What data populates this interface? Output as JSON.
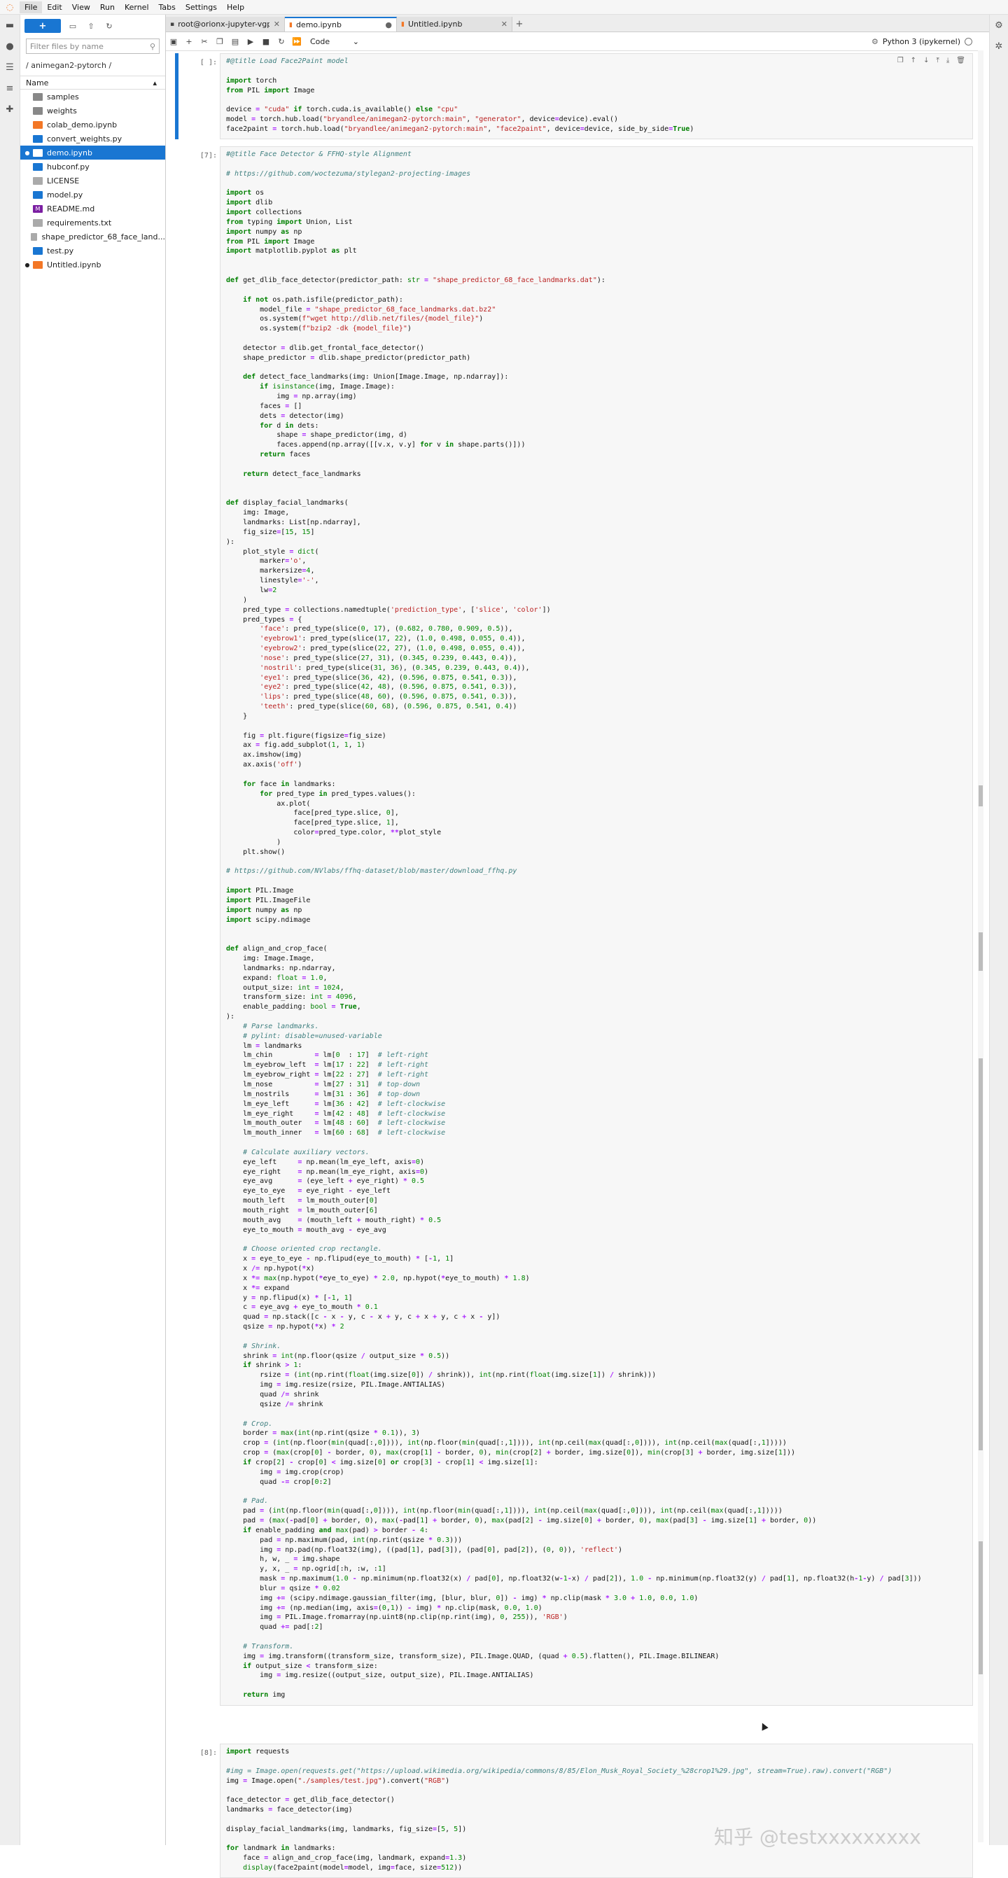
{
  "menubar": {
    "items": [
      "File",
      "Edit",
      "View",
      "Run",
      "Kernel",
      "Tabs",
      "Settings",
      "Help"
    ]
  },
  "filebrowser": {
    "new_label": "+",
    "search_placeholder": "Filter files by name",
    "breadcrumb": "/ animegan2-pytorch /",
    "column_name": "Name",
    "files": [
      {
        "name": "samples",
        "type": "folder",
        "running": false,
        "selected": false
      },
      {
        "name": "weights",
        "type": "folder",
        "running": false,
        "selected": false
      },
      {
        "name": "colab_demo.ipynb",
        "type": "notebook",
        "running": false,
        "selected": false
      },
      {
        "name": "convert_weights.py",
        "type": "python",
        "running": false,
        "selected": false
      },
      {
        "name": "demo.ipynb",
        "type": "notebook",
        "running": true,
        "selected": true
      },
      {
        "name": "hubconf.py",
        "type": "python",
        "running": false,
        "selected": false
      },
      {
        "name": "LICENSE",
        "type": "text",
        "running": false,
        "selected": false
      },
      {
        "name": "model.py",
        "type": "python",
        "running": false,
        "selected": false
      },
      {
        "name": "README.md",
        "type": "markdown",
        "running": false,
        "selected": false
      },
      {
        "name": "requirements.txt",
        "type": "text",
        "running": false,
        "selected": false
      },
      {
        "name": "shape_predictor_68_face_land...",
        "type": "text",
        "running": false,
        "selected": false
      },
      {
        "name": "test.py",
        "type": "python",
        "running": false,
        "selected": false
      },
      {
        "name": "Untitled.ipynb",
        "type": "notebook",
        "running": true,
        "selected": false
      }
    ]
  },
  "tabs": [
    {
      "label": "root@orionx-jupyter-vgpu:",
      "active": false
    },
    {
      "label": "demo.ipynb",
      "active": true
    },
    {
      "label": "Untitled.ipynb",
      "active": false
    }
  ],
  "toolbar": {
    "cell_type": "Code",
    "kernel": "Python 3 (ipykernel)"
  },
  "cells": [
    {
      "prompt": "[ ]:",
      "active": true,
      "lines": [
        "#@title Load Face2Paint model",
        "",
        "import torch",
        "from PIL import Image",
        "",
        "device = \"cuda\" if torch.cuda.is_available() else \"cpu\"",
        "model = torch.hub.load(\"bryandlee/animegan2-pytorch:main\", \"generator\", device=device).eval()",
        "face2paint = torch.hub.load(\"bryandlee/animegan2-pytorch:main\", \"face2paint\", device=device, side_by_side=True)"
      ]
    },
    {
      "prompt": "[7]:",
      "active": false,
      "lines": [
        "#@title Face Detector & FFHQ-style Alignment",
        "",
        "# https://github.com/woctezuma/stylegan2-projecting-images",
        "",
        "import os",
        "import dlib",
        "import collections",
        "from typing import Union, List",
        "import numpy as np",
        "from PIL import Image",
        "import matplotlib.pyplot as plt",
        "",
        "",
        "def get_dlib_face_detector(predictor_path: str = \"shape_predictor_68_face_landmarks.dat\"):",
        "",
        "    if not os.path.isfile(predictor_path):",
        "        model_file = \"shape_predictor_68_face_landmarks.dat.bz2\"",
        "        os.system(f\"wget http://dlib.net/files/{model_file}\")",
        "        os.system(f\"bzip2 -dk {model_file}\")",
        "",
        "    detector = dlib.get_frontal_face_detector()",
        "    shape_predictor = dlib.shape_predictor(predictor_path)",
        "",
        "    def detect_face_landmarks(img: Union[Image.Image, np.ndarray]):",
        "        if isinstance(img, Image.Image):",
        "            img = np.array(img)",
        "        faces = []",
        "        dets = detector(img)",
        "        for d in dets:",
        "            shape = shape_predictor(img, d)",
        "            faces.append(np.array([[v.x, v.y] for v in shape.parts()]))",
        "        return faces",
        "",
        "    return detect_face_landmarks",
        "",
        "",
        "def display_facial_landmarks(",
        "    img: Image,",
        "    landmarks: List[np.ndarray],",
        "    fig_size=[15, 15]",
        "):",
        "    plot_style = dict(",
        "        marker='o',",
        "        markersize=4,",
        "        linestyle='-',",
        "        lw=2",
        "    )",
        "    pred_type = collections.namedtuple('prediction_type', ['slice', 'color'])",
        "    pred_types = {",
        "        'face': pred_type(slice(0, 17), (0.682, 0.780, 0.909, 0.5)),",
        "        'eyebrow1': pred_type(slice(17, 22), (1.0, 0.498, 0.055, 0.4)),",
        "        'eyebrow2': pred_type(slice(22, 27), (1.0, 0.498, 0.055, 0.4)),",
        "        'nose': pred_type(slice(27, 31), (0.345, 0.239, 0.443, 0.4)),",
        "        'nostril': pred_type(slice(31, 36), (0.345, 0.239, 0.443, 0.4)),",
        "        'eye1': pred_type(slice(36, 42), (0.596, 0.875, 0.541, 0.3)),",
        "        'eye2': pred_type(slice(42, 48), (0.596, 0.875, 0.541, 0.3)),",
        "        'lips': pred_type(slice(48, 60), (0.596, 0.875, 0.541, 0.3)),",
        "        'teeth': pred_type(slice(60, 68), (0.596, 0.875, 0.541, 0.4))",
        "    }",
        "",
        "    fig = plt.figure(figsize=fig_size)",
        "    ax = fig.add_subplot(1, 1, 1)",
        "    ax.imshow(img)",
        "    ax.axis('off')",
        "",
        "    for face in landmarks:",
        "        for pred_type in pred_types.values():",
        "            ax.plot(",
        "                face[pred_type.slice, 0],",
        "                face[pred_type.slice, 1],",
        "                color=pred_type.color, **plot_style",
        "            )",
        "    plt.show()",
        "",
        "# https://github.com/NVlabs/ffhq-dataset/blob/master/download_ffhq.py",
        "",
        "import PIL.Image",
        "import PIL.ImageFile",
        "import numpy as np",
        "import scipy.ndimage",
        "",
        "",
        "def align_and_crop_face(",
        "    img: Image.Image,",
        "    landmarks: np.ndarray,",
        "    expand: float = 1.0,",
        "    output_size: int = 1024,",
        "    transform_size: int = 4096,",
        "    enable_padding: bool = True,",
        "):",
        "    # Parse landmarks.",
        "    # pylint: disable=unused-variable",
        "    lm = landmarks",
        "    lm_chin          = lm[0  : 17]  # left-right",
        "    lm_eyebrow_left  = lm[17 : 22]  # left-right",
        "    lm_eyebrow_right = lm[22 : 27]  # left-right",
        "    lm_nose          = lm[27 : 31]  # top-down",
        "    lm_nostrils      = lm[31 : 36]  # top-down",
        "    lm_eye_left      = lm[36 : 42]  # left-clockwise",
        "    lm_eye_right     = lm[42 : 48]  # left-clockwise",
        "    lm_mouth_outer   = lm[48 : 60]  # left-clockwise",
        "    lm_mouth_inner   = lm[60 : 68]  # left-clockwise",
        "",
        "    # Calculate auxiliary vectors.",
        "    eye_left     = np.mean(lm_eye_left, axis=0)",
        "    eye_right    = np.mean(lm_eye_right, axis=0)",
        "    eye_avg      = (eye_left + eye_right) * 0.5",
        "    eye_to_eye   = eye_right - eye_left",
        "    mouth_left   = lm_mouth_outer[0]",
        "    mouth_right  = lm_mouth_outer[6]",
        "    mouth_avg    = (mouth_left + mouth_right) * 0.5",
        "    eye_to_mouth = mouth_avg - eye_avg",
        "",
        "    # Choose oriented crop rectangle.",
        "    x = eye_to_eye - np.flipud(eye_to_mouth) * [-1, 1]",
        "    x /= np.hypot(*x)",
        "    x *= max(np.hypot(*eye_to_eye) * 2.0, np.hypot(*eye_to_mouth) * 1.8)",
        "    x *= expand",
        "    y = np.flipud(x) * [-1, 1]",
        "    c = eye_avg + eye_to_mouth * 0.1",
        "    quad = np.stack([c - x - y, c - x + y, c + x + y, c + x - y])",
        "    qsize = np.hypot(*x) * 2",
        "",
        "    # Shrink.",
        "    shrink = int(np.floor(qsize / output_size * 0.5))",
        "    if shrink > 1:",
        "        rsize = (int(np.rint(float(img.size[0]) / shrink)), int(np.rint(float(img.size[1]) / shrink)))",
        "        img = img.resize(rsize, PIL.Image.ANTIALIAS)",
        "        quad /= shrink",
        "        qsize /= shrink",
        "",
        "    # Crop.",
        "    border = max(int(np.rint(qsize * 0.1)), 3)",
        "    crop = (int(np.floor(min(quad[:,0]))), int(np.floor(min(quad[:,1]))), int(np.ceil(max(quad[:,0]))), int(np.ceil(max(quad[:,1]))))",
        "    crop = (max(crop[0] - border, 0), max(crop[1] - border, 0), min(crop[2] + border, img.size[0]), min(crop[3] + border, img.size[1]))",
        "    if crop[2] - crop[0] < img.size[0] or crop[3] - crop[1] < img.size[1]:",
        "        img = img.crop(crop)",
        "        quad -= crop[0:2]",
        "",
        "    # Pad.",
        "    pad = (int(np.floor(min(quad[:,0]))), int(np.floor(min(quad[:,1]))), int(np.ceil(max(quad[:,0]))), int(np.ceil(max(quad[:,1]))))",
        "    pad = (max(-pad[0] + border, 0), max(-pad[1] + border, 0), max(pad[2] - img.size[0] + border, 0), max(pad[3] - img.size[1] + border, 0))",
        "    if enable_padding and max(pad) > border - 4:",
        "        pad = np.maximum(pad, int(np.rint(qsize * 0.3)))",
        "        img = np.pad(np.float32(img), ((pad[1], pad[3]), (pad[0], pad[2]), (0, 0)), 'reflect')",
        "        h, w, _ = img.shape",
        "        y, x, _ = np.ogrid[:h, :w, :1]",
        "        mask = np.maximum(1.0 - np.minimum(np.float32(x) / pad[0], np.float32(w-1-x) / pad[2]), 1.0 - np.minimum(np.float32(y) / pad[1], np.float32(h-1-y) / pad[3]))",
        "        blur = qsize * 0.02",
        "        img += (scipy.ndimage.gaussian_filter(img, [blur, blur, 0]) - img) * np.clip(mask * 3.0 + 1.0, 0.0, 1.0)",
        "        img += (np.median(img, axis=(0,1)) - img) * np.clip(mask, 0.0, 1.0)",
        "        img = PIL.Image.fromarray(np.uint8(np.clip(np.rint(img), 0, 255)), 'RGB')",
        "        quad += pad[:2]",
        "",
        "    # Transform.",
        "    img = img.transform((transform_size, transform_size), PIL.Image.QUAD, (quad + 0.5).flatten(), PIL.Image.BILINEAR)",
        "    if output_size < transform_size:",
        "        img = img.resize((output_size, output_size), PIL.Image.ANTIALIAS)",
        "",
        "    return img"
      ]
    },
    {
      "prompt": "[8]:",
      "active": false,
      "lines": [
        "import requests",
        "",
        "#img = Image.open(requests.get(\"https://upload.wikimedia.org/wikipedia/commons/8/85/Elon_Musk_Royal_Society_%28crop1%29.jpg\", stream=True).raw).convert(\"RGB\")",
        "img = Image.open(\"./samples/test.jpg\").convert(\"RGB\")",
        "",
        "face_detector = get_dlib_face_detector()",
        "landmarks = face_detector(img)",
        "",
        "display_facial_landmarks(img, landmarks, fig_size=[5, 5])",
        "",
        "for landmark in landmarks:",
        "    face = align_and_crop_face(img, landmark, expand=1.3)",
        "    display(face2paint(model=model, img=face, size=512))"
      ]
    }
  ],
  "watermark": "知乎 @testxxxxxxxxx"
}
